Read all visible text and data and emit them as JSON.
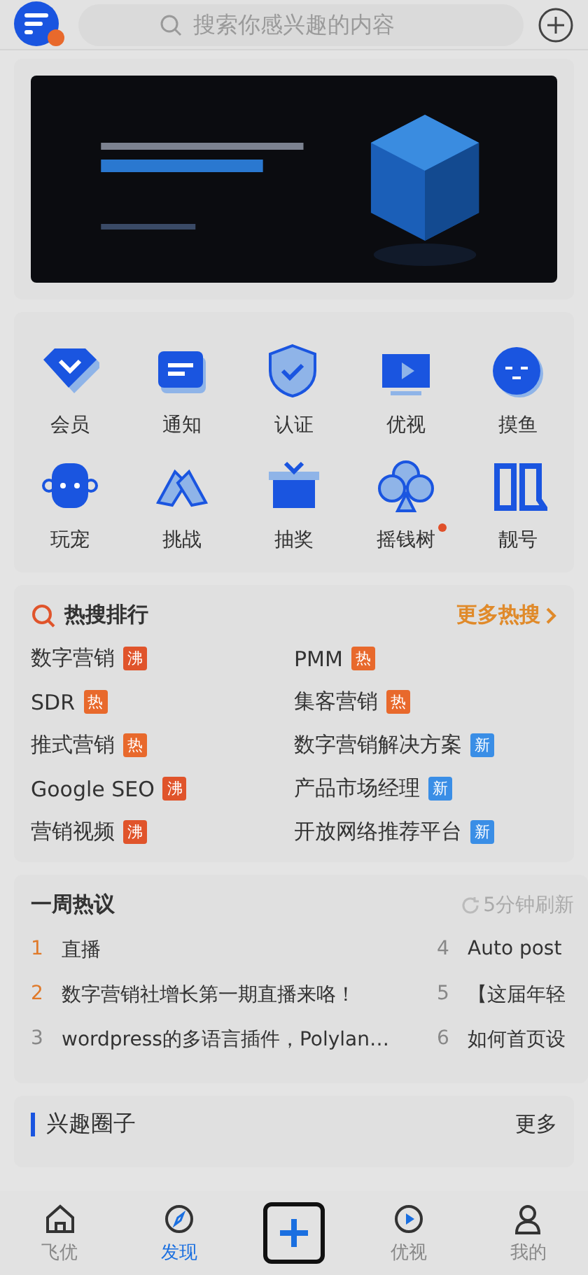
{
  "search": {
    "placeholder": "搜索你感兴趣的内容"
  },
  "shortcuts": [
    {
      "label": "会员",
      "dot": false
    },
    {
      "label": "通知",
      "dot": false
    },
    {
      "label": "认证",
      "dot": false
    },
    {
      "label": "优视",
      "dot": false
    },
    {
      "label": "摸鱼",
      "dot": false
    },
    {
      "label": "玩宠",
      "dot": false
    },
    {
      "label": "挑战",
      "dot": false
    },
    {
      "label": "抽奖",
      "dot": false
    },
    {
      "label": "摇钱树",
      "dot": true
    },
    {
      "label": "靓号",
      "dot": false
    }
  ],
  "hot_search": {
    "title": "热搜排行",
    "more": "更多热搜",
    "items": [
      {
        "text": "数字营销",
        "tag": "沸",
        "kind": "boil"
      },
      {
        "text": "PMM",
        "tag": "热",
        "kind": "hot"
      },
      {
        "text": "SDR",
        "tag": "热",
        "kind": "hot"
      },
      {
        "text": "集客营销",
        "tag": "热",
        "kind": "hot"
      },
      {
        "text": "推式营销",
        "tag": "热",
        "kind": "hot"
      },
      {
        "text": "数字营销解决方案",
        "tag": "新",
        "kind": "new"
      },
      {
        "text": "Google SEO",
        "tag": "沸",
        "kind": "boil"
      },
      {
        "text": "产品市场经理",
        "tag": "新",
        "kind": "new"
      },
      {
        "text": "营销视频",
        "tag": "沸",
        "kind": "boil"
      },
      {
        "text": "开放网络推荐平台",
        "tag": "新",
        "kind": "new"
      }
    ]
  },
  "weekly": {
    "title": "一周热议",
    "refresh": "5分钟刷新",
    "items": [
      {
        "rank": "1",
        "text": "直播",
        "top": true
      },
      {
        "rank": "2",
        "text": "数字营销社增长第一期直播来咯！",
        "top": true
      },
      {
        "rank": "3",
        "text": "wordpress的多语言插件，Polylan…",
        "top": false
      },
      {
        "rank": "4",
        "text": "Auto post",
        "top": false
      },
      {
        "rank": "5",
        "text": "【这届年轻",
        "top": false
      },
      {
        "rank": "6",
        "text": "如何首页设",
        "top": false
      }
    ]
  },
  "circles": {
    "title": "兴趣圈子",
    "more": "更多"
  },
  "nav": [
    {
      "label": "飞优",
      "selected": false
    },
    {
      "label": "发现",
      "selected": true
    },
    {
      "kind": "plus"
    },
    {
      "label": "优视",
      "selected": false
    },
    {
      "label": "我的",
      "selected": false
    }
  ]
}
